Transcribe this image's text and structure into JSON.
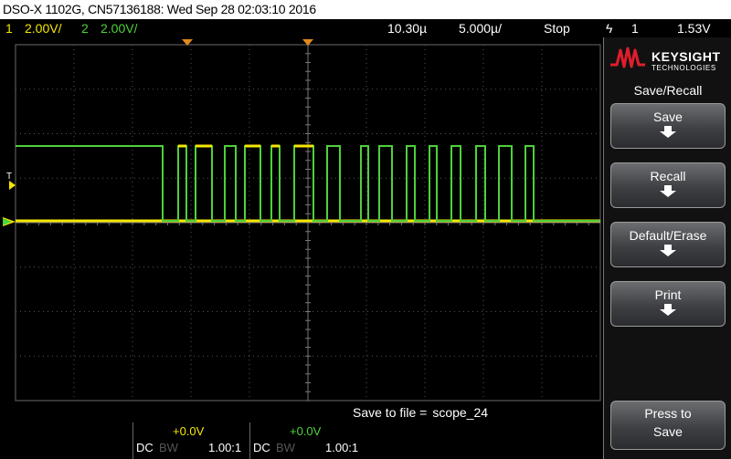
{
  "title_bar": {
    "text": "DSO-X 1102G, CN57136188: Wed Sep 28 02:03:10 2016"
  },
  "status_bar": {
    "ch1_num": "1",
    "ch1_scale": "2.00V/",
    "ch2_num": "2",
    "ch2_scale": "2.00V/",
    "time_delay": "10.30µ",
    "time_scale": "5.000µ/",
    "run_state": "Stop",
    "trigger_icon": "ϟ",
    "trigger_source": "1",
    "trigger_level": "1.53V"
  },
  "waveform": {
    "ch1_color": "#f5e600",
    "ch2_color": "#4dd13a",
    "trigger_marker_label": "T",
    "ground_marker_label": "1"
  },
  "bottom_bar": {
    "save_prefix": "Save to file =",
    "save_filename": "scope_24",
    "ch1": {
      "offset": "+0.0V",
      "coupling": "DC",
      "bw": "BW",
      "probe": "1.00:1"
    },
    "ch2": {
      "offset": "+0.0V",
      "coupling": "DC",
      "bw": "BW",
      "probe": "1.00:1"
    }
  },
  "softkeys": {
    "logo_brand": "KEYSIGHT",
    "logo_sub": "TECHNOLOGIES",
    "menu_title": "Save/Recall",
    "buttons": [
      {
        "label": "Save"
      },
      {
        "label": "Recall"
      },
      {
        "label": "Default/Erase"
      },
      {
        "label": "Print"
      }
    ],
    "press_to_save": {
      "line1": "Press to",
      "line2": "Save"
    }
  }
}
